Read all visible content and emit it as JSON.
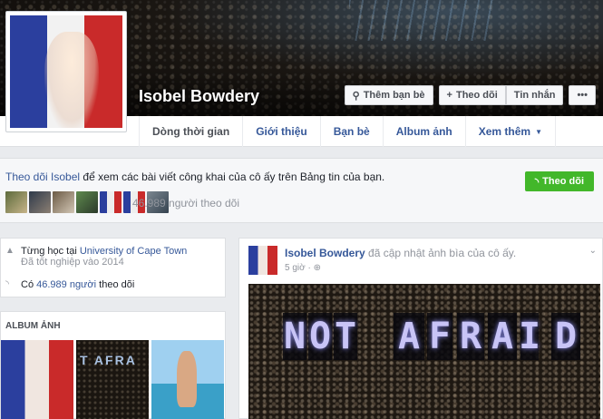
{
  "profile": {
    "name": "Isobel Bowdery",
    "profile_pic_icon": "profile-photo-french-flag",
    "cover_icon": "concert-crowd-cover"
  },
  "cover_buttons": {
    "add_friend": "Thêm bạn bè",
    "follow": "Theo dõi",
    "message": "Tin nhắn",
    "more": "•••"
  },
  "nav": {
    "tabs": [
      {
        "label": "Dòng thời gian"
      },
      {
        "label": "Giới thiệu"
      },
      {
        "label": "Bạn bè"
      },
      {
        "label": "Album ảnh"
      },
      {
        "label": "Xem thêm"
      }
    ]
  },
  "follow_box": {
    "link": "Theo dõi Isobel",
    "text": " để xem các bài viết công khai của cô ấy trên Bảng tin của bạn.",
    "followers": "46.989 người theo dõi",
    "button": "Theo dõi"
  },
  "intro": {
    "school_prefix": "Từng học tại ",
    "school": "University of Cape Town",
    "graduated": "Đã tốt nghiệp vào 2014",
    "followers_prefix": "Có ",
    "followers_count": "46.989 người",
    "followers_suffix": " theo dõi"
  },
  "album": {
    "title": "ALBUM ẢNH",
    "photo2_text": "T AFRA"
  },
  "post": {
    "author": "Isobel Bowdery",
    "action": " đã cập nhật ảnh bìa của cô ấy.",
    "time": "5 giờ",
    "sign_letters": [
      "N",
      "O",
      "T",
      "A",
      "F",
      "R",
      "A",
      "I",
      "D"
    ]
  },
  "colors": {
    "link": "#365899",
    "follow_green": "#42b72a",
    "background": "#e9ebee"
  }
}
